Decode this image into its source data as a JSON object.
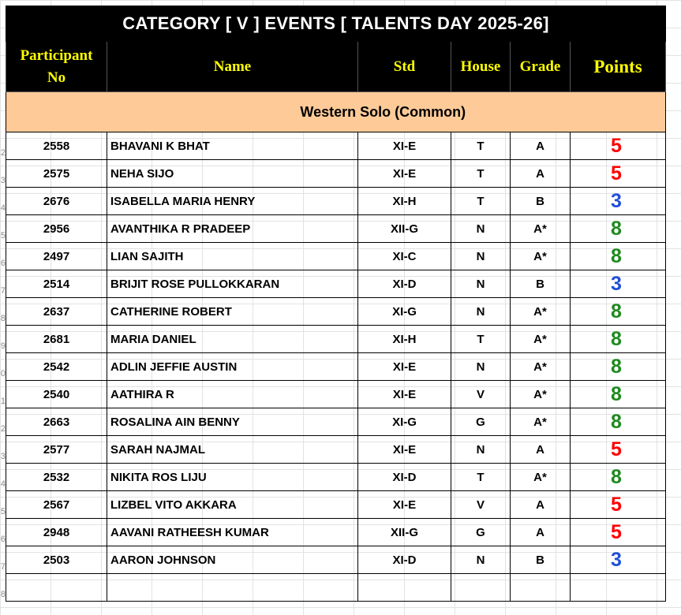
{
  "title": "CATEGORY  [ V ]   EVENTS   [ TALENTS DAY 2025-26]",
  "headers": {
    "participant_no": [
      "Participant",
      "No"
    ],
    "name": "Name",
    "std": "Std",
    "house": "House",
    "grade": "Grade",
    "points": "Points"
  },
  "section_title": "Western Solo (Common)",
  "row_numbers": [
    "2",
    "3",
    "4",
    "5",
    "6",
    "7",
    "8",
    "9",
    "0",
    "1",
    "2",
    "3",
    "4",
    "5",
    "6",
    "7",
    "8"
  ],
  "point_colors": {
    "5": "#ff0000",
    "3": "#1f4fd8",
    "8": "#1e8a1e"
  },
  "rows": [
    {
      "no": "2558",
      "name": "BHAVANI K BHAT",
      "std": "XI-E",
      "house": "T",
      "grade": "A",
      "points": "5"
    },
    {
      "no": "2575",
      "name": "NEHA SIJO",
      "std": "XI-E",
      "house": "T",
      "grade": "A",
      "points": "5"
    },
    {
      "no": "2676",
      "name": "ISABELLA MARIA HENRY",
      "std": "XI-H",
      "house": "T",
      "grade": "B",
      "points": "3"
    },
    {
      "no": "2956",
      "name": "AVANTHIKA R PRADEEP",
      "std": "XII-G",
      "house": "N",
      "grade": "A*",
      "points": "8"
    },
    {
      "no": "2497",
      "name": "LIAN SAJITH",
      "std": "XI-C",
      "house": "N",
      "grade": "A*",
      "points": "8"
    },
    {
      "no": "2514",
      "name": "BRIJIT ROSE PULLOKKARAN",
      "std": "XI-D",
      "house": "N",
      "grade": "B",
      "points": "3"
    },
    {
      "no": "2637",
      "name": "CATHERINE ROBERT",
      "std": "XI-G",
      "house": "N",
      "grade": "A*",
      "points": "8"
    },
    {
      "no": "2681",
      "name": "MARIA DANIEL",
      "std": "XI-H",
      "house": "T",
      "grade": "A*",
      "points": "8"
    },
    {
      "no": "2542",
      "name": "ADLIN JEFFIE AUSTIN",
      "std": "XI-E",
      "house": "N",
      "grade": "A*",
      "points": "8"
    },
    {
      "no": "2540",
      "name": "AATHIRA R",
      "std": "XI-E",
      "house": "V",
      "grade": "A*",
      "points": "8"
    },
    {
      "no": "2663",
      "name": "ROSALINA AIN BENNY",
      "std": "XI-G",
      "house": "G",
      "grade": "A*",
      "points": "8"
    },
    {
      "no": "2577",
      "name": "SARAH NAJMAL",
      "std": "XI-E",
      "house": "N",
      "grade": "A",
      "points": "5"
    },
    {
      "no": "2532",
      "name": "NIKITA ROS LIJU",
      "std": "XI-D",
      "house": "T",
      "grade": "A*",
      "points": "8"
    },
    {
      "no": "2567",
      "name": "LIZBEL VITO AKKARA",
      "std": "XI-E",
      "house": "V",
      "grade": "A",
      "points": "5"
    },
    {
      "no": "2948",
      "name": "AAVANI RATHEESH KUMAR",
      "std": "XII-G",
      "house": "G",
      "grade": "A",
      "points": "5"
    },
    {
      "no": "2503",
      "name": "AARON JOHNSON",
      "std": "XI-D",
      "house": "N",
      "grade": "B",
      "points": "3"
    }
  ]
}
